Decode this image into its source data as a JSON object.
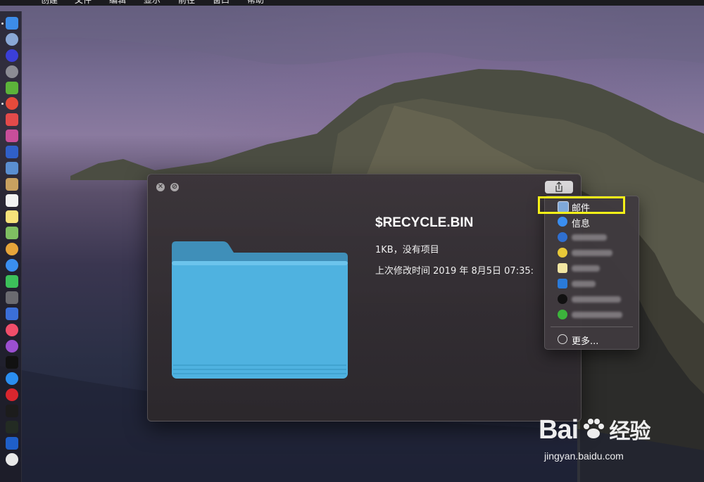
{
  "menubar": {
    "items": [
      "创建",
      "文件",
      "编辑",
      "显示",
      "前往",
      "窗口",
      "帮助"
    ]
  },
  "quicklook": {
    "close_glyph": "✕",
    "fullscreen_glyph": "⊘",
    "file_name": "$RECYCLE.BIN",
    "file_size": "1KB，没有项目",
    "modified": "上次修改时间 2019 年 8月5日 07:35:",
    "share_icon": "share-icon"
  },
  "share_menu": {
    "mail": "邮件",
    "messages": "信息",
    "more": "更多..."
  },
  "watermark": {
    "brand": "Bai",
    "brand_cn": "经验",
    "url": "jingyan.baidu.com"
  },
  "colors": {
    "highlight": "#f4f018",
    "folder": "#4fb2e0"
  }
}
